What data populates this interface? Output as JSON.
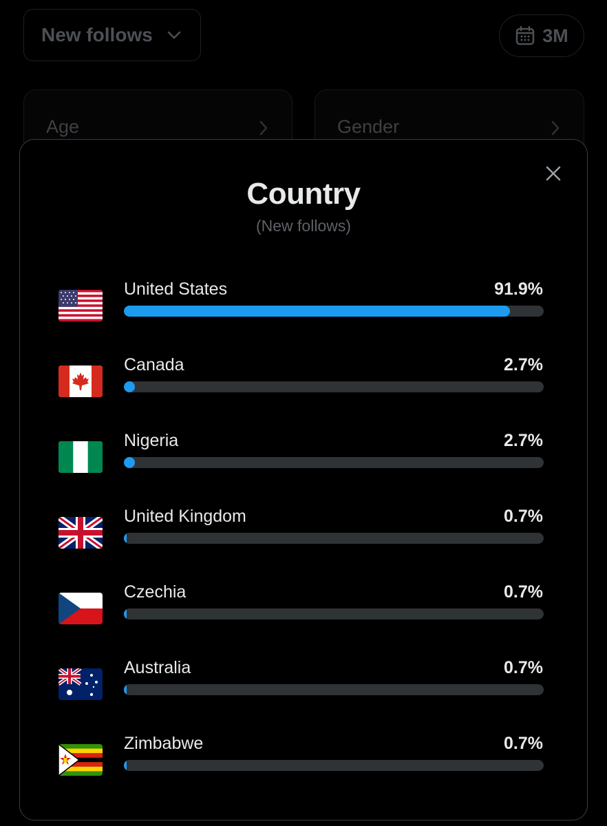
{
  "background": {
    "filter_label": "New follows",
    "range_label": "3M",
    "cards": [
      {
        "label": "Age"
      },
      {
        "label": "Gender"
      }
    ]
  },
  "modal": {
    "title": "Country",
    "subtitle": "(New follows)",
    "countries": [
      {
        "name": "United States",
        "percent_label": "91.9%",
        "percent": 91.9,
        "flag_icon": "us-flag-icon"
      },
      {
        "name": "Canada",
        "percent_label": "2.7%",
        "percent": 2.7,
        "flag_icon": "canada-flag-icon"
      },
      {
        "name": "Nigeria",
        "percent_label": "2.7%",
        "percent": 2.7,
        "flag_icon": "nigeria-flag-icon"
      },
      {
        "name": "United Kingdom",
        "percent_label": "0.7%",
        "percent": 0.7,
        "flag_icon": "uk-flag-icon"
      },
      {
        "name": "Czechia",
        "percent_label": "0.7%",
        "percent": 0.7,
        "flag_icon": "czechia-flag-icon"
      },
      {
        "name": "Australia",
        "percent_label": "0.7%",
        "percent": 0.7,
        "flag_icon": "australia-flag-icon"
      },
      {
        "name": "Zimbabwe",
        "percent_label": "0.7%",
        "percent": 0.7,
        "flag_icon": "zimbabwe-flag-icon"
      }
    ]
  },
  "colors": {
    "accent": "#1d9bf0",
    "track": "#2f3336",
    "background": "#000000"
  }
}
